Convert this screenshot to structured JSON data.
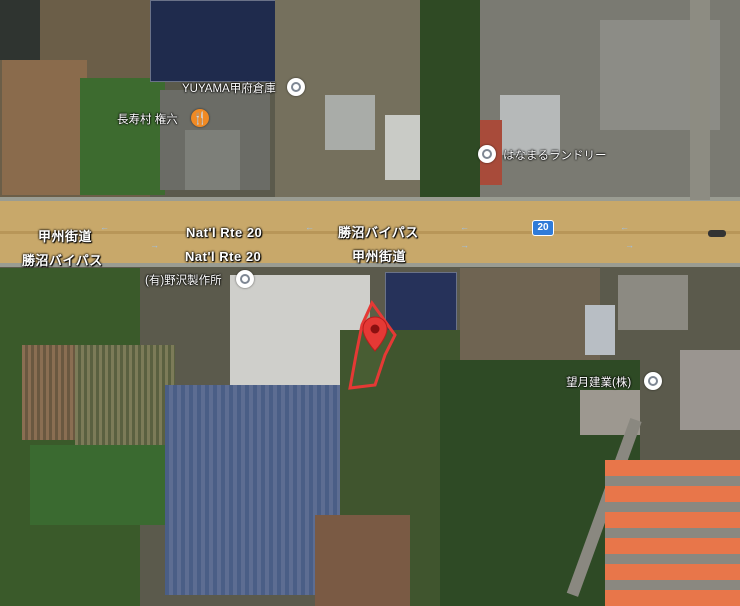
{
  "roads": [
    {
      "id": "road-label-koshu-kaido-west",
      "text": "甲州街道"
    },
    {
      "id": "road-label-natl-rte-20-upper",
      "text": "Nat'l Rte 20"
    },
    {
      "id": "road-label-katsunuma-bypass-upper",
      "text": "勝沼バイパス"
    },
    {
      "id": "road-label-katsunuma-bypass-west",
      "text": "勝沼バイパス"
    },
    {
      "id": "road-label-natl-rte-20-lower",
      "text": "Nat'l Rte 20"
    },
    {
      "id": "road-label-koshu-kaido-lower",
      "text": "甲州街道"
    }
  ],
  "route_shield": {
    "number": "20",
    "color": "#2f7bd8"
  },
  "places": [
    {
      "name": "YUYAMA甲府倉庫",
      "icon": "place-icon"
    },
    {
      "name": "長寿村 権六",
      "icon": "restaurant-icon"
    },
    {
      "name": "はなまるランドリー",
      "icon": "place-icon"
    },
    {
      "name": "(有)野沢製作所",
      "icon": "place-icon"
    },
    {
      "name": "望月建業(株)",
      "icon": "place-icon"
    }
  ],
  "selected_pin": {
    "icon": "map-pin-icon",
    "color": "#e53935"
  },
  "colors": {
    "highway": "#c8a86a",
    "highlight_outline": "#e53935",
    "vegetation": "#3f5e2c"
  }
}
